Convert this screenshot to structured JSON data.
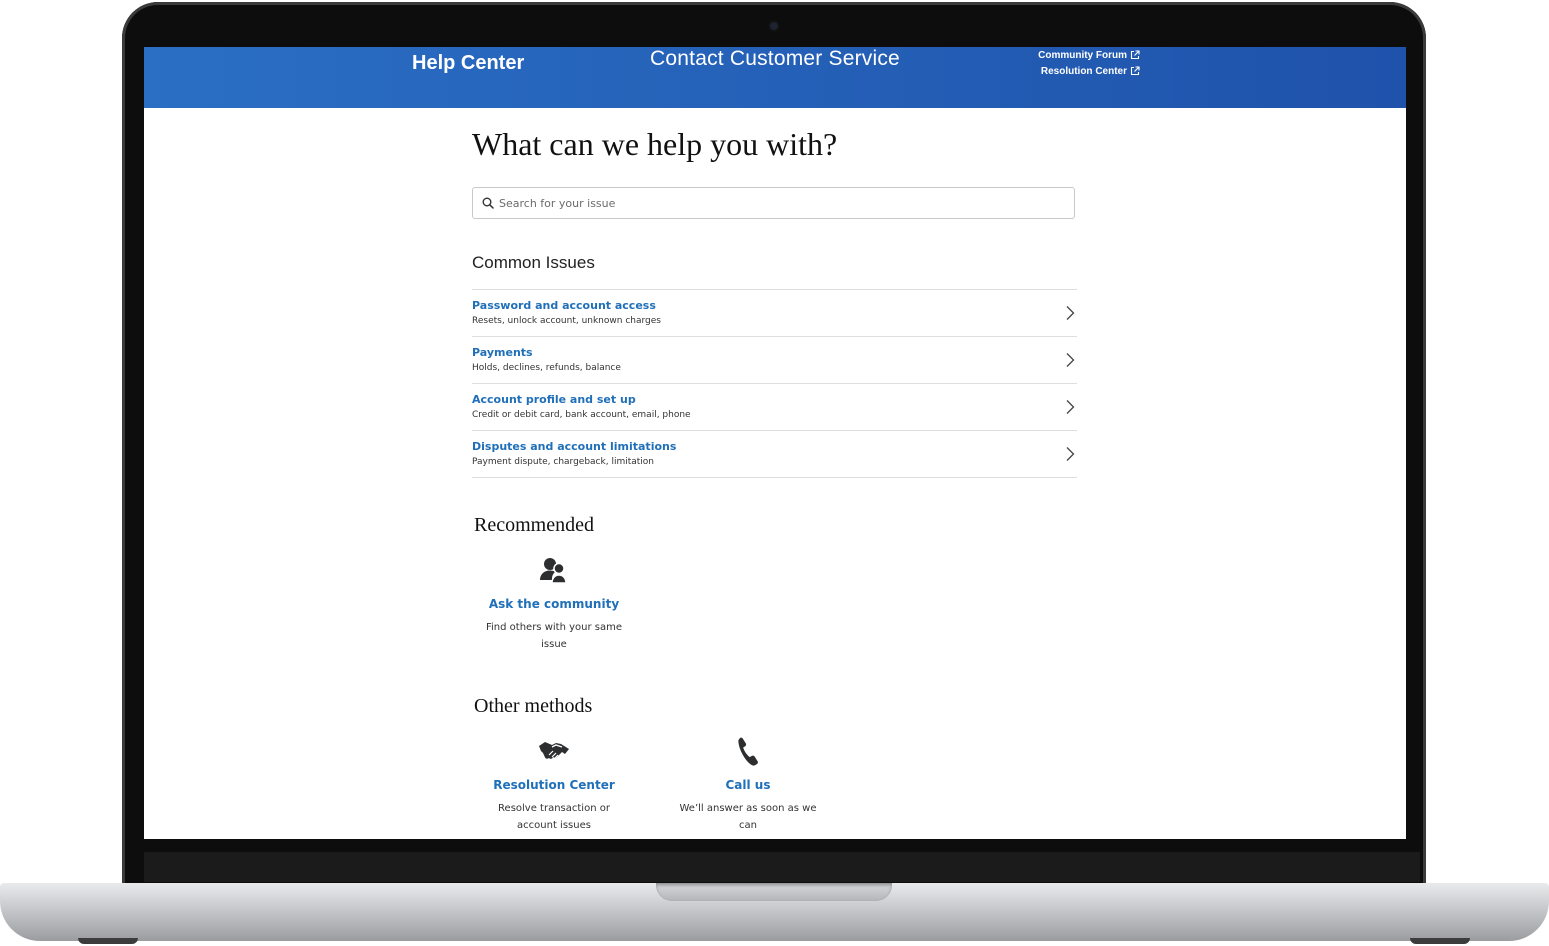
{
  "header": {
    "brand": "Help Center",
    "title": "Contact Customer Service",
    "links": [
      {
        "label": "Community Forum",
        "icon": "external-link-icon"
      },
      {
        "label": "Resolution Center",
        "icon": "external-link-icon"
      }
    ]
  },
  "main": {
    "title": "What can we help you with?",
    "search": {
      "placeholder": "Search for your issue",
      "icon": "search-icon"
    },
    "common_issues": {
      "heading": "Common Issues",
      "items": [
        {
          "title": "Password and account access",
          "desc": "Resets, unlock account, unknown charges"
        },
        {
          "title": "Payments",
          "desc": "Holds, declines, refunds, balance"
        },
        {
          "title": "Account profile and set up",
          "desc": "Credit or debit card, bank account, email, phone"
        },
        {
          "title": "Disputes and account limitations",
          "desc": "Payment dispute, chargeback, limitation"
        }
      ]
    },
    "recommended": {
      "heading": "Recommended",
      "items": [
        {
          "title": "Ask the community",
          "desc": "Find others with your same issue",
          "icon": "community-icon"
        }
      ]
    },
    "other_methods": {
      "heading": "Other methods",
      "items": [
        {
          "title": "Resolution Center",
          "desc": "Resolve transaction or account issues",
          "icon": "handshake-icon"
        },
        {
          "title": "Call us",
          "desc": "We’ll answer as soon as we can",
          "icon": "phone-icon"
        }
      ]
    }
  },
  "colors": {
    "header_start": "#2a6fc4",
    "header_end": "#1f52ab",
    "link": "#1f6fb9"
  }
}
